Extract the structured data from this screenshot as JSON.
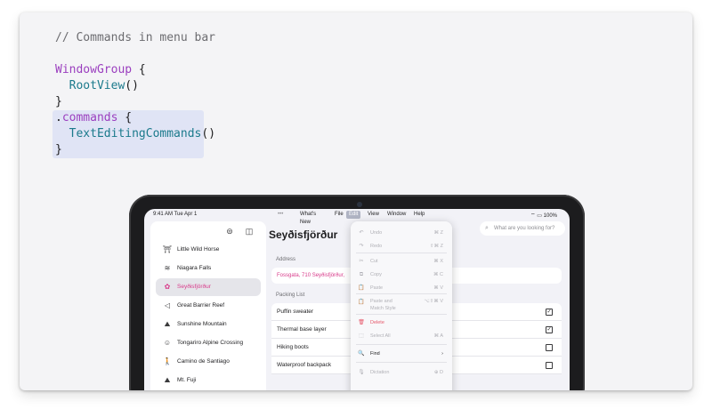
{
  "code": {
    "comment": "// Commands in menu bar",
    "window_group": "WindowGroup",
    "open_brace": " {",
    "root_view": "RootView",
    "parens": "()",
    "close_brace": "}",
    "dot": ".",
    "commands": "commands",
    "text_editing": "TextEditingCommands",
    "highlight_color": "#e0e4f5"
  },
  "status_bar": {
    "time": "9:41 AM  Tue Apr 1",
    "battery": "100%"
  },
  "menu_bar": {
    "dots": "•••",
    "items": [
      "What's New",
      "File",
      "Edit",
      "View",
      "Window",
      "Help"
    ],
    "active": "Edit"
  },
  "sidebar": {
    "items": [
      {
        "label": "Little Wild Horse",
        "icon": "horse-icon",
        "glyph": "⛩"
      },
      {
        "label": "Niagara Falls",
        "icon": "water-icon",
        "glyph": "≋"
      },
      {
        "label": "Seyðisfjörður",
        "icon": "sparkle-icon",
        "glyph": "✿"
      },
      {
        "label": "Great Barrier Reef",
        "icon": "fish-icon",
        "glyph": "◁"
      },
      {
        "label": "Sunshine Mountain",
        "icon": "mountain-icon",
        "glyph": "⛰"
      },
      {
        "label": "Tongariro Alpine Crossing",
        "icon": "face-icon",
        "glyph": "☺"
      },
      {
        "label": "Camino de Santiago",
        "icon": "walk-icon",
        "glyph": "🚶"
      },
      {
        "label": "Mt. Fuji",
        "icon": "mountain-icon",
        "glyph": "⛰"
      }
    ],
    "selected_index": 2
  },
  "detail": {
    "title": "Seyðisfjörður",
    "address_label": "Address",
    "address_value": "Fossgata, 710 Seyðisfjörður,",
    "packing_label": "Packing List",
    "packing": [
      {
        "label": "Puffin sweater",
        "checked": true
      },
      {
        "label": "Thermal base layer",
        "checked": true
      },
      {
        "label": "Hiking boots",
        "checked": false
      },
      {
        "label": "Waterproof backpack",
        "checked": false
      }
    ],
    "more_button": "•••",
    "search_placeholder": "What are you looking for?"
  },
  "edit_menu": {
    "items": [
      {
        "label": "Undo",
        "shortcut": "⌘ Z",
        "glyph": "↶",
        "state": "disabled"
      },
      {
        "label": "Redo",
        "shortcut": "⇧⌘ Z",
        "glyph": "↷",
        "state": "disabled"
      },
      {
        "label": "Cut",
        "shortcut": "⌘ X",
        "glyph": "✂",
        "state": "disabled"
      },
      {
        "label": "Copy",
        "shortcut": "⌘ C",
        "glyph": "⧉",
        "state": "disabled"
      },
      {
        "label": "Paste",
        "shortcut": "⌘ V",
        "glyph": "📋",
        "state": "disabled"
      },
      {
        "label": "Paste and",
        "label2": "Match Style",
        "shortcut": "⌥⇧⌘ V",
        "glyph": "📋",
        "state": "disabled"
      },
      {
        "label": "Delete",
        "shortcut": "",
        "glyph": "🗑",
        "state": "danger"
      },
      {
        "label": "Select All",
        "shortcut": "⌘ A",
        "glyph": "⬚",
        "state": "disabled"
      },
      {
        "label": "Find",
        "shortcut": "›",
        "glyph": "🔍",
        "state": "enabled"
      },
      {
        "label": "Dictation",
        "shortcut": "⊕ D",
        "glyph": "🎙",
        "state": "disabled"
      }
    ]
  },
  "colors": {
    "accent": "#d83a8a",
    "danger": "#e6586a",
    "menu_active": "#b0b4c4"
  }
}
